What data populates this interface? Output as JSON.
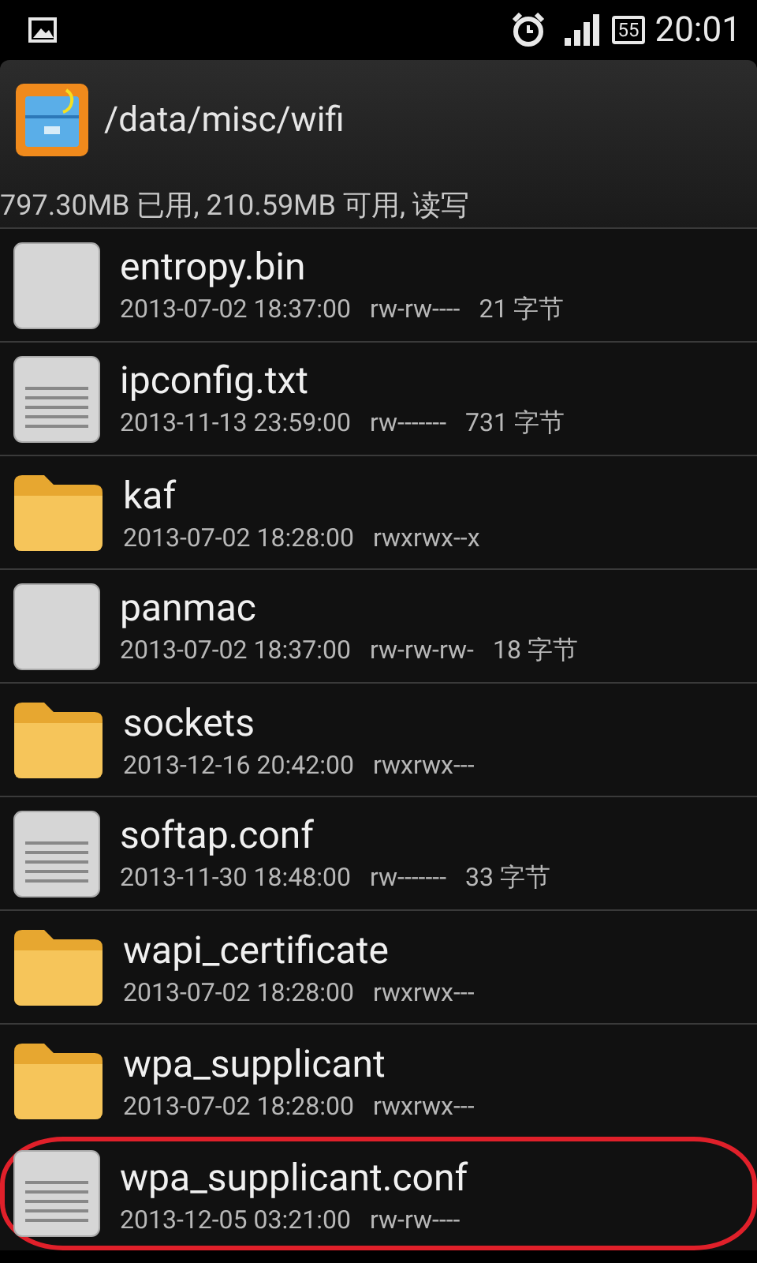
{
  "status_bar": {
    "time": "20:01",
    "battery": "55"
  },
  "header": {
    "path": "/data/misc/wifi",
    "storage": "797.30MB 已用, 210.59MB 可用, 读写"
  },
  "files": [
    {
      "kind": "blank",
      "name": "entropy.bin",
      "date": "2013-07-02 18:37:00",
      "perms": "rw-rw----",
      "size": "21 字节",
      "highlighted": false
    },
    {
      "kind": "text",
      "name": "ipconfig.txt",
      "date": "2013-11-13 23:59:00",
      "perms": "rw-------",
      "size": "731 字节",
      "highlighted": false
    },
    {
      "kind": "folder",
      "name": "kaf",
      "date": "2013-07-02 18:28:00",
      "perms": "rwxrwx--x",
      "highlighted": false
    },
    {
      "kind": "blank",
      "name": "panmac",
      "date": "2013-07-02 18:37:00",
      "perms": "rw-rw-rw-",
      "size": "18 字节",
      "highlighted": false
    },
    {
      "kind": "folder",
      "name": "sockets",
      "date": "2013-12-16 20:42:00",
      "perms": "rwxrwx---",
      "highlighted": false
    },
    {
      "kind": "text",
      "name": "softap.conf",
      "date": "2013-11-30 18:48:00",
      "perms": "rw-------",
      "size": "33 字节",
      "highlighted": false
    },
    {
      "kind": "folder",
      "name": "wapi_certificate",
      "date": "2013-07-02 18:28:00",
      "perms": "rwxrwx---",
      "highlighted": false
    },
    {
      "kind": "folder",
      "name": "wpa_supplicant",
      "date": "2013-07-02 18:28:00",
      "perms": "rwxrwx---",
      "highlighted": false
    },
    {
      "kind": "text",
      "name": "wpa_supplicant.conf",
      "date": "2013-12-05 03:21:00",
      "perms": "rw-rw----",
      "highlighted": true
    }
  ]
}
